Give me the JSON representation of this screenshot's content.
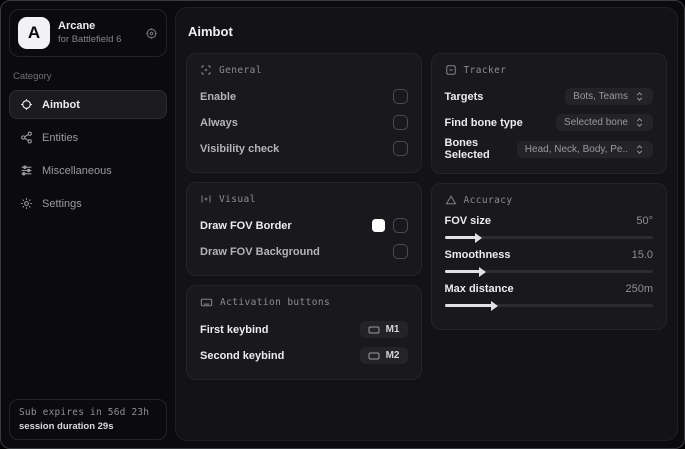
{
  "colors": {
    "window_bg": "#0b0b0d",
    "panel_bg": "#131316",
    "card_bg": "#19191d",
    "accent_text": "#ececef",
    "muted_text": "#8b8b92",
    "swatch_fov_border": "#ffffff"
  },
  "sidebar": {
    "logo": {
      "letter": "A",
      "title": "Arcane",
      "subtitle": "for Battlefield 6",
      "action_icon": "crosshair-target-icon"
    },
    "category_label": "Category",
    "items": [
      {
        "label": "Aimbot",
        "icon": "crosshair-icon",
        "selected": true
      },
      {
        "label": "Entities",
        "icon": "entities-icon",
        "selected": false
      },
      {
        "label": "Miscellaneous",
        "icon": "sliders-icon",
        "selected": false
      },
      {
        "label": "Settings",
        "icon": "gear-icon",
        "selected": false
      }
    ],
    "footer": {
      "line1": "Sub expires in 56d 23h",
      "line2": "session duration 29s"
    }
  },
  "main": {
    "title": "Aimbot",
    "cards": {
      "general": {
        "title": "General",
        "icon": "scan-icon",
        "rows": [
          {
            "label": "Enable",
            "control": "checkbox",
            "checked": false
          },
          {
            "label": "Always",
            "control": "checkbox",
            "checked": false
          },
          {
            "label": "Visibility check",
            "control": "checkbox",
            "checked": false
          }
        ]
      },
      "visual": {
        "title": "Visual",
        "icon": "focus-icon",
        "rows": [
          {
            "label": "Draw FOV Border",
            "control": "color+checkbox",
            "checked": false,
            "swatch": "#ffffff"
          },
          {
            "label": "Draw FOV Background",
            "control": "checkbox",
            "checked": false
          }
        ]
      },
      "activation": {
        "title": "Activation buttons",
        "icon": "keyboard-icon",
        "rows": [
          {
            "label": "First keybind",
            "key": "M1"
          },
          {
            "label": "Second keybind",
            "key": "M2"
          }
        ]
      },
      "tracker": {
        "title": "Tracker",
        "icon": "box-minus-icon",
        "rows": [
          {
            "label": "Targets",
            "value": "Bots, Teams"
          },
          {
            "label": "Find bone type",
            "value": "Selected bone"
          },
          {
            "label": "Bones Selected",
            "value": "Head, Neck, Body, Pe.."
          }
        ]
      },
      "accuracy": {
        "title": "Accuracy",
        "icon": "triangle-icon",
        "rows": [
          {
            "label": "FOV size",
            "value": "50°",
            "fill_pct": 15
          },
          {
            "label": "Smoothness",
            "value": "15.0",
            "fill_pct": 17
          },
          {
            "label": "Max distance",
            "value": "250m",
            "fill_pct": 23
          }
        ]
      }
    }
  }
}
